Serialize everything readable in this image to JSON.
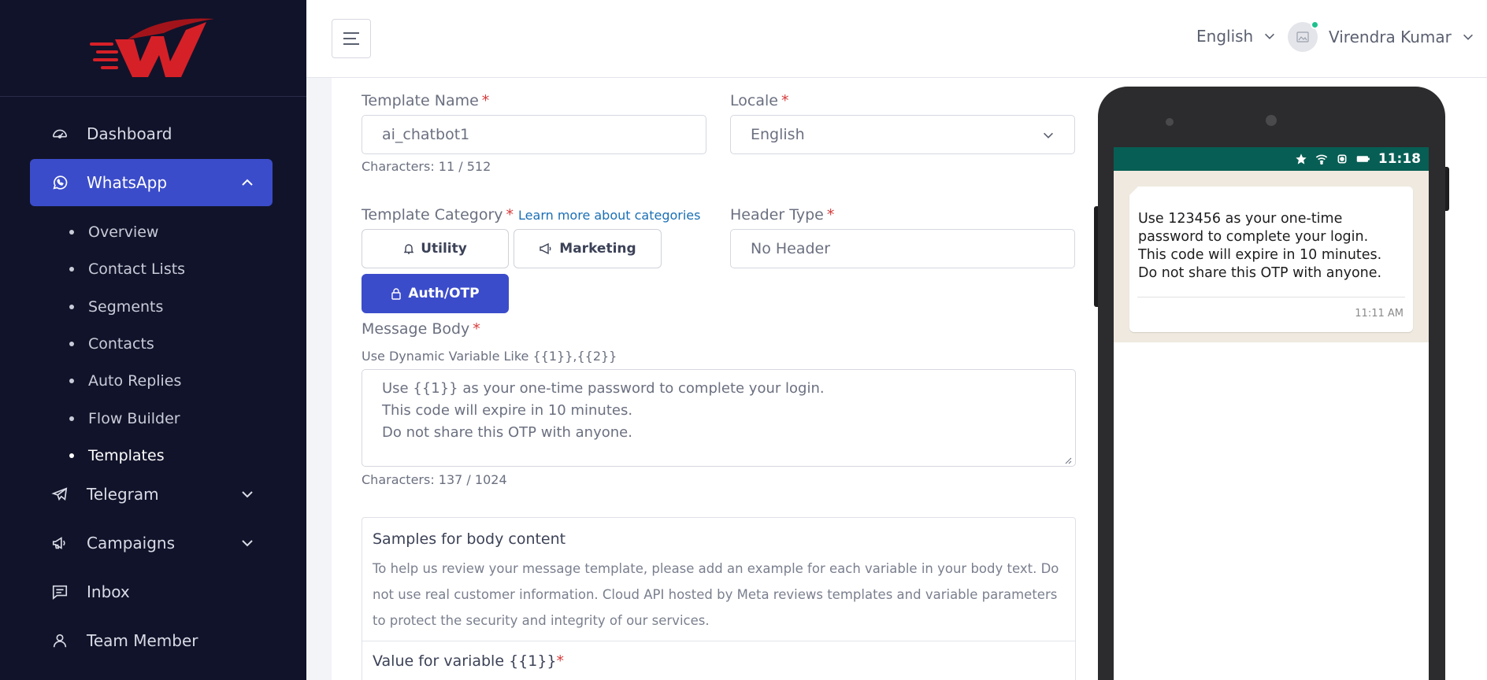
{
  "topbar": {
    "language": "English",
    "user_name": "Virendra Kumar"
  },
  "sidebar": {
    "items": [
      {
        "label": "Dashboard",
        "icon": "dashboard-icon"
      },
      {
        "label": "WhatsApp",
        "icon": "whatsapp-icon",
        "active": true,
        "expanded": true
      },
      {
        "label": "Telegram",
        "icon": "telegram-icon"
      },
      {
        "label": "Campaigns",
        "icon": "megaphone-icon"
      },
      {
        "label": "Inbox",
        "icon": "inbox-icon"
      },
      {
        "label": "Team Member",
        "icon": "user-icon"
      }
    ],
    "whatsapp_sub": [
      "Overview",
      "Contact Lists",
      "Segments",
      "Contacts",
      "Auto Replies",
      "Flow Builder",
      "Templates"
    ]
  },
  "form": {
    "template_name_label": "Template Name",
    "template_name_value": "ai_chatbot1",
    "template_name_chars": "Characters: 11 / 512",
    "locale_label": "Locale",
    "locale_value": "English",
    "category_label": "Template Category",
    "category_link": "Learn more about categories",
    "categories": [
      "Utility",
      "Marketing",
      "Auth/OTP"
    ],
    "selected_category": "Auth/OTP",
    "header_type_label": "Header Type",
    "header_type_value": "No Header",
    "body_label": "Message Body",
    "body_hint": "Use Dynamic Variable Like {{1}},{{2}}",
    "body_text": "Use {{1}} as your one-time password to complete your login.\nThis code will expire in 10 minutes.\nDo not share this OTP with anyone.",
    "body_chars": "Characters: 137 / 1024",
    "samples_title": "Samples for body content",
    "samples_desc": "To help us review your message template, please add an example for each variable in your body text. Do not use real customer information. Cloud API hosted by Meta reviews templates and variable parameters to protect the security and integrity of our services.",
    "variable_label": "Value for variable {{1}}"
  },
  "preview": {
    "status_time": "11:18",
    "message": "Use 123456 as your one-time password to complete your login.\nThis code will expire in 10 minutes.\nDo not share this OTP with anyone.",
    "message_time": "11:11 AM"
  },
  "colors": {
    "sidebar_bg": "#11132a",
    "accent": "#3b4cca",
    "whatsapp_green": "#075e54",
    "required": "#d63a3a",
    "logo_red": "#d62027"
  }
}
